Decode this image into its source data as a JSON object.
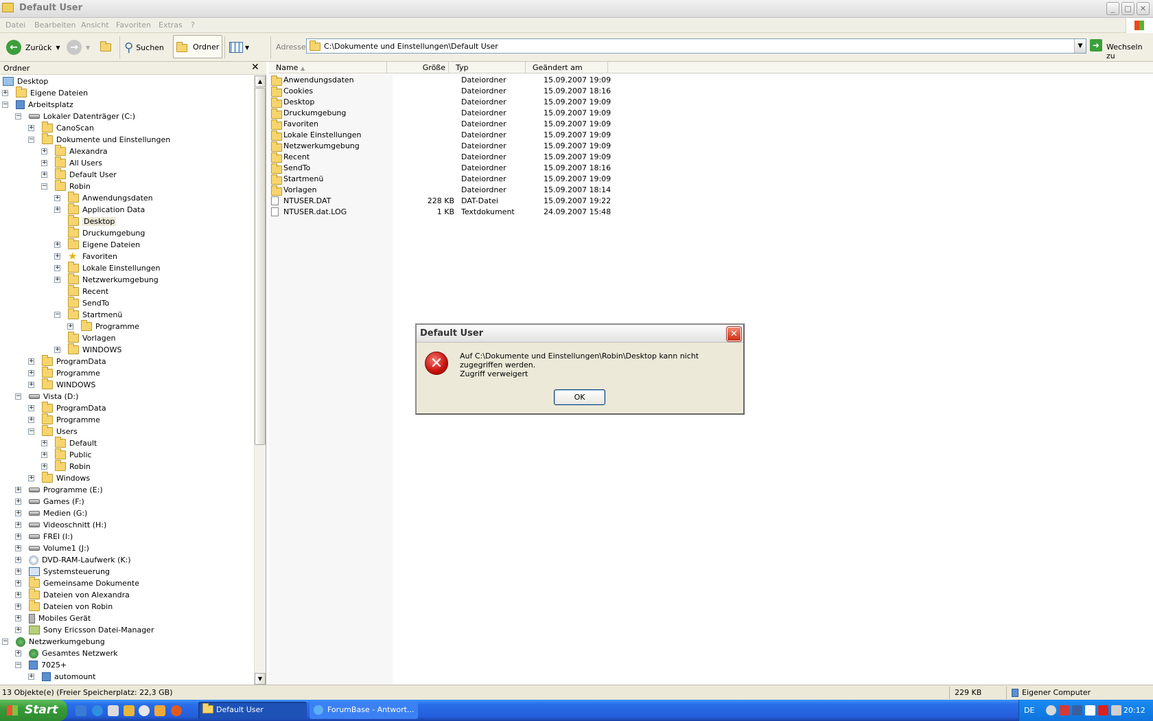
{
  "window": {
    "title": "Default User",
    "controls": {
      "minimize": "_",
      "maximize": "□",
      "close": "✕"
    }
  },
  "menu": [
    "Datei",
    "Bearbeiten",
    "Ansicht",
    "Favoriten",
    "Extras",
    "?"
  ],
  "toolbar": {
    "back": "Zurück",
    "search": "Suchen",
    "folders": "Ordner",
    "address_label": "Adresse",
    "address": "C:\\Dokumente und Einstellungen\\Default User",
    "go": "Wechseln zu"
  },
  "folder_pane": {
    "title": "Ordner",
    "close": "✕",
    "tree": [
      {
        "label": "Desktop",
        "icon": "desktop-icon",
        "level": 0,
        "exp": ""
      },
      {
        "label": "Eigene Dateien",
        "icon": "my-documents-icon",
        "level": 1,
        "exp": "+"
      },
      {
        "label": "Arbeitsplatz",
        "icon": "my-computer-icon",
        "level": 1,
        "exp": "-"
      },
      {
        "label": "Lokaler Datenträger (C:)",
        "icon": "drive-icon",
        "level": 2,
        "exp": "-"
      },
      {
        "label": "CanoScan",
        "icon": "folder-icon",
        "level": 3,
        "exp": "+"
      },
      {
        "label": "Dokumente und Einstellungen",
        "icon": "folder-icon",
        "level": 3,
        "exp": "-"
      },
      {
        "label": "Alexandra",
        "icon": "folder-icon",
        "level": 4,
        "exp": "+"
      },
      {
        "label": "All Users",
        "icon": "folder-icon",
        "level": 4,
        "exp": "+"
      },
      {
        "label": "Default User",
        "icon": "folder-icon",
        "level": 4,
        "exp": "+"
      },
      {
        "label": "Robin",
        "icon": "folder-icon",
        "level": 4,
        "exp": "-"
      },
      {
        "label": "Anwendungsdaten",
        "icon": "folder-icon",
        "level": 5,
        "exp": "+"
      },
      {
        "label": "Application Data",
        "icon": "folder-icon",
        "level": 5,
        "exp": "+"
      },
      {
        "label": "Desktop",
        "icon": "folder-icon",
        "level": 5,
        "exp": "",
        "selected": true
      },
      {
        "label": "Druckumgebung",
        "icon": "folder-icon",
        "level": 5,
        "exp": ""
      },
      {
        "label": "Eigene Dateien",
        "icon": "folder-icon",
        "level": 5,
        "exp": "+"
      },
      {
        "label": "Favoriten",
        "icon": "star-icon",
        "level": 5,
        "exp": "+"
      },
      {
        "label": "Lokale Einstellungen",
        "icon": "folder-icon",
        "level": 5,
        "exp": "+"
      },
      {
        "label": "Netzwerkumgebung",
        "icon": "folder-icon",
        "level": 5,
        "exp": "+"
      },
      {
        "label": "Recent",
        "icon": "folder-icon",
        "level": 5,
        "exp": ""
      },
      {
        "label": "SendTo",
        "icon": "folder-icon",
        "level": 5,
        "exp": ""
      },
      {
        "label": "Startmenü",
        "icon": "folder-icon",
        "level": 5,
        "exp": "-"
      },
      {
        "label": "Programme",
        "icon": "programs-icon",
        "level": 6,
        "exp": "+"
      },
      {
        "label": "Vorlagen",
        "icon": "folder-icon",
        "level": 5,
        "exp": ""
      },
      {
        "label": "WINDOWS",
        "icon": "folder-icon",
        "level": 5,
        "exp": "+"
      },
      {
        "label": "ProgramData",
        "icon": "folder-icon",
        "level": 3,
        "exp": "+"
      },
      {
        "label": "Programme",
        "icon": "folder-icon",
        "level": 3,
        "exp": "+"
      },
      {
        "label": "WINDOWS",
        "icon": "folder-icon",
        "level": 3,
        "exp": "+"
      },
      {
        "label": "Vista (D:)",
        "icon": "drive-icon",
        "level": 2,
        "exp": "-"
      },
      {
        "label": "ProgramData",
        "icon": "folder-icon",
        "level": 3,
        "exp": "+"
      },
      {
        "label": "Programme",
        "icon": "folder-icon",
        "level": 3,
        "exp": "+"
      },
      {
        "label": "Users",
        "icon": "folder-icon",
        "level": 3,
        "exp": "-"
      },
      {
        "label": "Default",
        "icon": "folder-icon",
        "level": 4,
        "exp": "+"
      },
      {
        "label": "Public",
        "icon": "folder-icon",
        "level": 4,
        "exp": "+"
      },
      {
        "label": "Robin",
        "icon": "folder-icon",
        "level": 4,
        "exp": "+"
      },
      {
        "label": "Windows",
        "icon": "folder-icon",
        "level": 3,
        "exp": "+"
      },
      {
        "label": "Programme (E:)",
        "icon": "drive-icon",
        "level": 2,
        "exp": "+"
      },
      {
        "label": "Games (F:)",
        "icon": "drive-icon",
        "level": 2,
        "exp": "+"
      },
      {
        "label": "Medien (G:)",
        "icon": "drive-icon",
        "level": 2,
        "exp": "+"
      },
      {
        "label": "Videoschnitt (H:)",
        "icon": "drive-icon",
        "level": 2,
        "exp": "+"
      },
      {
        "label": "FREI (I:)",
        "icon": "drive-icon",
        "level": 2,
        "exp": "+"
      },
      {
        "label": "Volume1 (J:)",
        "icon": "drive-icon",
        "level": 2,
        "exp": "+"
      },
      {
        "label": "DVD-RAM-Laufwerk (K:)",
        "icon": "dvd-icon",
        "level": 2,
        "exp": "+"
      },
      {
        "label": "Systemsteuerung",
        "icon": "control-panel-icon",
        "level": 2,
        "exp": "+"
      },
      {
        "label": "Gemeinsame Dokumente",
        "icon": "folder-icon",
        "level": 2,
        "exp": "+"
      },
      {
        "label": "Dateien von Alexandra",
        "icon": "folder-icon",
        "level": 2,
        "exp": "+"
      },
      {
        "label": "Dateien von Robin",
        "icon": "folder-icon",
        "level": 2,
        "exp": "+"
      },
      {
        "label": "Mobiles Gerät",
        "icon": "phone-icon",
        "level": 2,
        "exp": "+"
      },
      {
        "label": "Sony Ericsson Datei-Manager",
        "icon": "sony-icon",
        "level": 2,
        "exp": "+"
      },
      {
        "label": "Netzwerkumgebung",
        "icon": "network-icon",
        "level": 1,
        "exp": "-"
      },
      {
        "label": "Gesamtes Netzwerk",
        "icon": "globe-icon",
        "level": 2,
        "exp": "+"
      },
      {
        "label": "7025+",
        "icon": "network-computer-icon",
        "level": 2,
        "exp": "-"
      },
      {
        "label": "automount",
        "icon": "network-computer-icon",
        "level": 3,
        "exp": "+"
      }
    ]
  },
  "file_list": {
    "columns": [
      "Name",
      "Größe",
      "Typ",
      "Geändert am"
    ],
    "rows": [
      {
        "name": "Anwendungsdaten",
        "size": "",
        "type": "Dateiordner",
        "date": "15.09.2007 19:09",
        "icon": "folder-icon"
      },
      {
        "name": "Cookies",
        "size": "",
        "type": "Dateiordner",
        "date": "15.09.2007 18:16",
        "icon": "folder-icon"
      },
      {
        "name": "Desktop",
        "size": "",
        "type": "Dateiordner",
        "date": "15.09.2007 19:09",
        "icon": "folder-icon"
      },
      {
        "name": "Druckumgebung",
        "size": "",
        "type": "Dateiordner",
        "date": "15.09.2007 19:09",
        "icon": "folder-icon"
      },
      {
        "name": "Favoriten",
        "size": "",
        "type": "Dateiordner",
        "date": "15.09.2007 19:09",
        "icon": "folder-icon"
      },
      {
        "name": "Lokale Einstellungen",
        "size": "",
        "type": "Dateiordner",
        "date": "15.09.2007 19:09",
        "icon": "folder-icon"
      },
      {
        "name": "Netzwerkumgebung",
        "size": "",
        "type": "Dateiordner",
        "date": "15.09.2007 19:09",
        "icon": "folder-icon"
      },
      {
        "name": "Recent",
        "size": "",
        "type": "Dateiordner",
        "date": "15.09.2007 19:09",
        "icon": "folder-icon"
      },
      {
        "name": "SendTo",
        "size": "",
        "type": "Dateiordner",
        "date": "15.09.2007 18:16",
        "icon": "folder-icon"
      },
      {
        "name": "Startmenü",
        "size": "",
        "type": "Dateiordner",
        "date": "15.09.2007 19:09",
        "icon": "folder-icon"
      },
      {
        "name": "Vorlagen",
        "size": "",
        "type": "Dateiordner",
        "date": "15.09.2007 18:14",
        "icon": "folder-icon"
      },
      {
        "name": "NTUSER.DAT",
        "size": "228 KB",
        "type": "DAT-Datei",
        "date": "15.09.2007 19:22",
        "icon": "file-icon"
      },
      {
        "name": "NTUSER.dat.LOG",
        "size": "1 KB",
        "type": "Textdokument",
        "date": "24.09.2007 15:48",
        "icon": "text-file-icon"
      }
    ]
  },
  "status": {
    "objects": "13 Objekte(e) (Freier Speicherplatz: 22,3 GB)",
    "size": "229 KB",
    "zone": "Eigener Computer"
  },
  "dialog": {
    "title": "Default User",
    "message": "Auf C:\\Dokumente und Einstellungen\\Robin\\Desktop kann nicht zugegriffen werden.",
    "detail": "Zugriff verweigert",
    "ok": "OK",
    "close": "✕",
    "icon_glyph": "✕"
  },
  "taskbar": {
    "start": "Start",
    "tasks": [
      "Default User",
      "ForumBase - Antwort..."
    ],
    "lang": "DE",
    "clock": "20:12"
  }
}
